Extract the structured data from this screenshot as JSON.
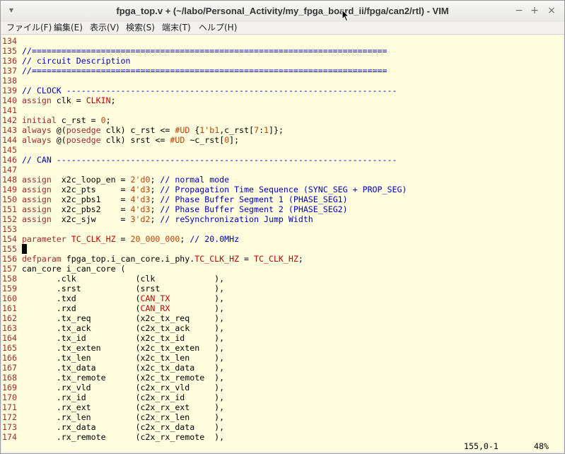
{
  "window": {
    "title": "fpga_top.v + (~/labo/Personal_Activity/my_fpga_board_ii/fpga/can2/rtl) - VIM",
    "controls": [
      "−",
      "+",
      "×"
    ]
  },
  "menubar": {
    "items": [
      "ファイル(F)",
      "編集(E)",
      "表示(V)",
      "検索(S)",
      "端末(T)",
      "ヘルプ(H)"
    ]
  },
  "editor": {
    "lines": [
      {
        "n": "134",
        "t": ""
      },
      {
        "n": "135",
        "t": "//========================================================================"
      },
      {
        "n": "136",
        "t": "// circuit Description"
      },
      {
        "n": "137",
        "t": "//========================================================================"
      },
      {
        "n": "138",
        "t": ""
      },
      {
        "n": "139",
        "t": "// CLOCK -------------------------------------------------------------------"
      },
      {
        "n": "140",
        "t": "assign clk = CLKIN;"
      },
      {
        "n": "141",
        "t": ""
      },
      {
        "n": "142",
        "t": "initial c_rst = 0;"
      },
      {
        "n": "143",
        "t": "always @(posedge clk) c_rst <= #UD {1'b1,c_rst[7:1]};"
      },
      {
        "n": "144",
        "t": "always @(posedge clk) srst <= #UD ~c_rst[0];"
      },
      {
        "n": "145",
        "t": ""
      },
      {
        "n": "146",
        "t": "// CAN ---------------------------------------------------------------------"
      },
      {
        "n": "147",
        "t": ""
      },
      {
        "n": "148",
        "t": "assign  x2c_loop_en = 2'd0; // normal mode"
      },
      {
        "n": "149",
        "t": "assign  x2c_pts     = 4'd3; // Propagation Time Sequence (SYNC_SEG + PROP_SEG)"
      },
      {
        "n": "150",
        "t": "assign  x2c_pbs1    = 4'd3; // Phase Buffer Segment 1 (PHASE_SEG1)"
      },
      {
        "n": "151",
        "t": "assign  x2c_pbs2    = 4'd3; // Phase Buffer Segment 2 (PHASE_SEG2)"
      },
      {
        "n": "152",
        "t": "assign  x2c_sjw     = 3'd2; // reSynchronization Jump Width"
      },
      {
        "n": "153",
        "t": ""
      },
      {
        "n": "154",
        "t": "parameter TC_CLK_HZ = 20_000_000; // 20.0MHz"
      },
      {
        "n": "155",
        "t": ""
      },
      {
        "n": "156",
        "t": "defparam fpga_top.i_can_core.i_phy.TC_CLK_HZ = TC_CLK_HZ;"
      },
      {
        "n": "157",
        "t": "can_core i_can_core ("
      },
      {
        "n": "158",
        "t": "       .clk            (clk            ),"
      },
      {
        "n": "159",
        "t": "       .srst           (srst           ),"
      },
      {
        "n": "160",
        "t": "       .txd            (CAN_TX         ),"
      },
      {
        "n": "161",
        "t": "       .rxd            (CAN_RX         ),"
      },
      {
        "n": "162",
        "t": "       .tx_req         (x2c_tx_req     ),"
      },
      {
        "n": "163",
        "t": "       .tx_ack         (c2x_tx_ack     ),"
      },
      {
        "n": "164",
        "t": "       .tx_id          (x2c_tx_id      ),"
      },
      {
        "n": "165",
        "t": "       .tx_exten       (x2c_tx_exten   ),"
      },
      {
        "n": "166",
        "t": "       .tx_len         (x2c_tx_len     ),"
      },
      {
        "n": "167",
        "t": "       .tx_data        (x2c_tx_data    ),"
      },
      {
        "n": "168",
        "t": "       .tx_remote      (x2c_tx_remote  ),"
      },
      {
        "n": "169",
        "t": "       .rx_vld         (c2x_rx_vld     ),"
      },
      {
        "n": "170",
        "t": "       .rx_id          (c2x_rx_id      ),"
      },
      {
        "n": "171",
        "t": "       .rx_ext         (c2x_rx_ext     ),"
      },
      {
        "n": "172",
        "t": "       .rx_len         (c2x_rx_len     ),"
      },
      {
        "n": "173",
        "t": "       .rx_data        (c2x_rx_data    ),"
      },
      {
        "n": "174",
        "t": "       .rx_remote      (c2x_rx_remote  ),"
      }
    ]
  },
  "status": {
    "position": "155,0-1",
    "percent": "48%"
  }
}
